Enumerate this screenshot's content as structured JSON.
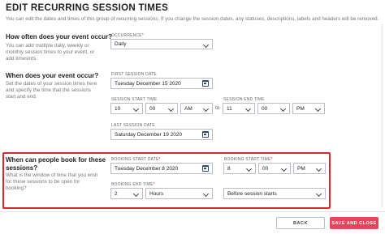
{
  "header": {
    "title": "EDIT RECURRING SESSION TIMES",
    "intro": "You can edit the dates and times of this group of recurring sessions. If you change the session dates, any statuses, descriptions, labels and headers will be removed."
  },
  "occurrence_section": {
    "question": "How often does your event occur?",
    "help_lines": [
      "You can add multiple daily, weekly or",
      "monthly session times to your event, or",
      "add timeslots."
    ],
    "label": "OCCURRENCE",
    "value": "Daily"
  },
  "when_section": {
    "question": "When does your event occur?",
    "help_lines": [
      "Set the dates of your session times here",
      "and specify the time that the sessions",
      "start and end."
    ],
    "first_date_label": "FIRST SESSION DATE",
    "first_date_value": "Tuesday December 15 2020",
    "start_time_label": "SESSION START TIME",
    "start_hour": "10",
    "start_minute": "00",
    "start_ampm": "AM",
    "to_text": "to",
    "end_time_label": "SESSION END TIME",
    "end_hour": "11",
    "end_minute": "00",
    "end_ampm": "PM",
    "last_date_label": "LAST SESSION DATE",
    "last_date_value": "Saturday December 19 2020"
  },
  "booking_section": {
    "question_lines": [
      "When can people book for these",
      "sessions?"
    ],
    "help_lines": [
      "What is the window of time that you wish",
      "for these sessions to be open for",
      "booking?"
    ],
    "start_date_label": "BOOKING START DATE",
    "start_date_value": "Tuesday December 8 2020",
    "start_time_label": "BOOKING START TIME",
    "start_hour": "8",
    "start_minute": "00",
    "start_ampm": "PM",
    "end_time_label": "BOOKING END TIME",
    "end_amount": "2",
    "end_unit": "Hours",
    "end_relative": "Before session starts"
  },
  "footer": {
    "back_label": "BACK",
    "save_label": "SAVE AND CLOSE"
  },
  "required_mark": "*",
  "colors": {
    "accent": "#e2475c",
    "highlight": "#d9262f"
  }
}
